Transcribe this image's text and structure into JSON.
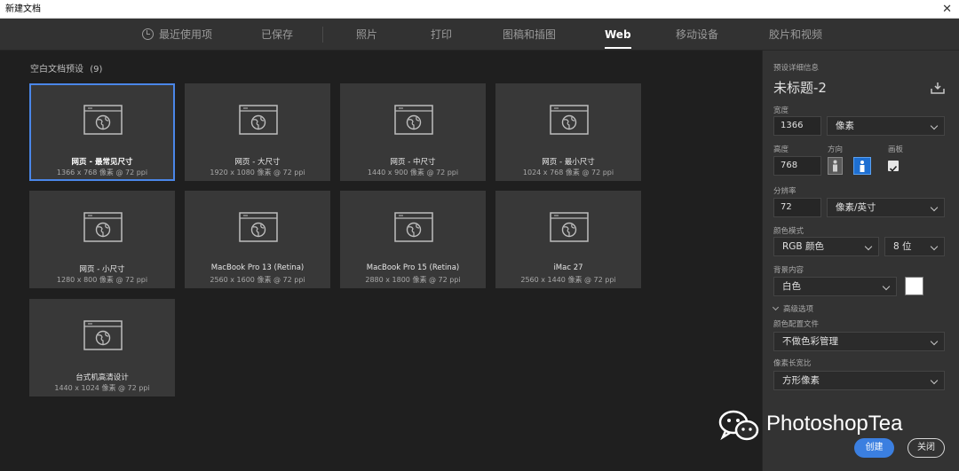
{
  "window": {
    "title": "新建文档"
  },
  "tabs": [
    {
      "label": "最近使用项",
      "active": false
    },
    {
      "label": "已保存",
      "active": false
    },
    {
      "label": "照片",
      "active": false
    },
    {
      "label": "打印",
      "active": false
    },
    {
      "label": "图稿和插图",
      "active": false
    },
    {
      "label": "Web",
      "active": true
    },
    {
      "label": "移动设备",
      "active": false
    },
    {
      "label": "胶片和视频",
      "active": false
    }
  ],
  "presets": {
    "title": "空白文档预设",
    "count": "(9)",
    "items": [
      {
        "name": "网页 - 最常见尺寸",
        "spec": "1366 x 768 像素 @ 72 ppi",
        "selected": true
      },
      {
        "name": "网页 - 大尺寸",
        "spec": "1920 x 1080 像素 @ 72 ppi"
      },
      {
        "name": "网页 - 中尺寸",
        "spec": "1440 x 900 像素 @ 72 ppi"
      },
      {
        "name": "网页 - 最小尺寸",
        "spec": "1024 x 768 像素 @ 72 ppi"
      },
      {
        "name": "网页 - 小尺寸",
        "spec": "1280 x 800 像素 @ 72 ppi"
      },
      {
        "name": "MacBook Pro 13 (Retina)",
        "spec": "2560 x 1600 像素 @ 72 ppi"
      },
      {
        "name": "MacBook Pro 15 (Retina)",
        "spec": "2880 x 1800 像素 @ 72 ppi"
      },
      {
        "name": "iMac 27",
        "spec": "2560 x 1440 像素 @ 72 ppi"
      },
      {
        "name": "台式机高清设计",
        "spec": "1440 x 1024 像素 @ 72 ppi"
      }
    ]
  },
  "details": {
    "header": "预设详细信息",
    "doc_name": "未标题-2",
    "width_label": "宽度",
    "width_value": "1366",
    "width_unit": "像素",
    "height_label": "高度",
    "height_value": "768",
    "orientation_label": "方向",
    "artboard_label": "画板",
    "resolution_label": "分辨率",
    "resolution_value": "72",
    "resolution_unit": "像素/英寸",
    "color_mode_label": "颜色模式",
    "color_mode_value": "RGB 颜色",
    "bit_depth_value": "8 位",
    "background_label": "背景内容",
    "background_value": "白色",
    "advanced_label": "高级选项",
    "color_profile_label": "颜色配置文件",
    "color_profile_value": "不做色彩管理",
    "pixel_aspect_label": "像素长宽比",
    "pixel_aspect_value": "方形像素"
  },
  "buttons": {
    "create": "创建",
    "close": "关闭"
  },
  "watermark": {
    "text": "PhotoshopTea"
  },
  "colors": {
    "accent": "#4a86e8",
    "create_button": "#3b7fe0",
    "panel": "#333333",
    "content": "#1f1f1f"
  }
}
